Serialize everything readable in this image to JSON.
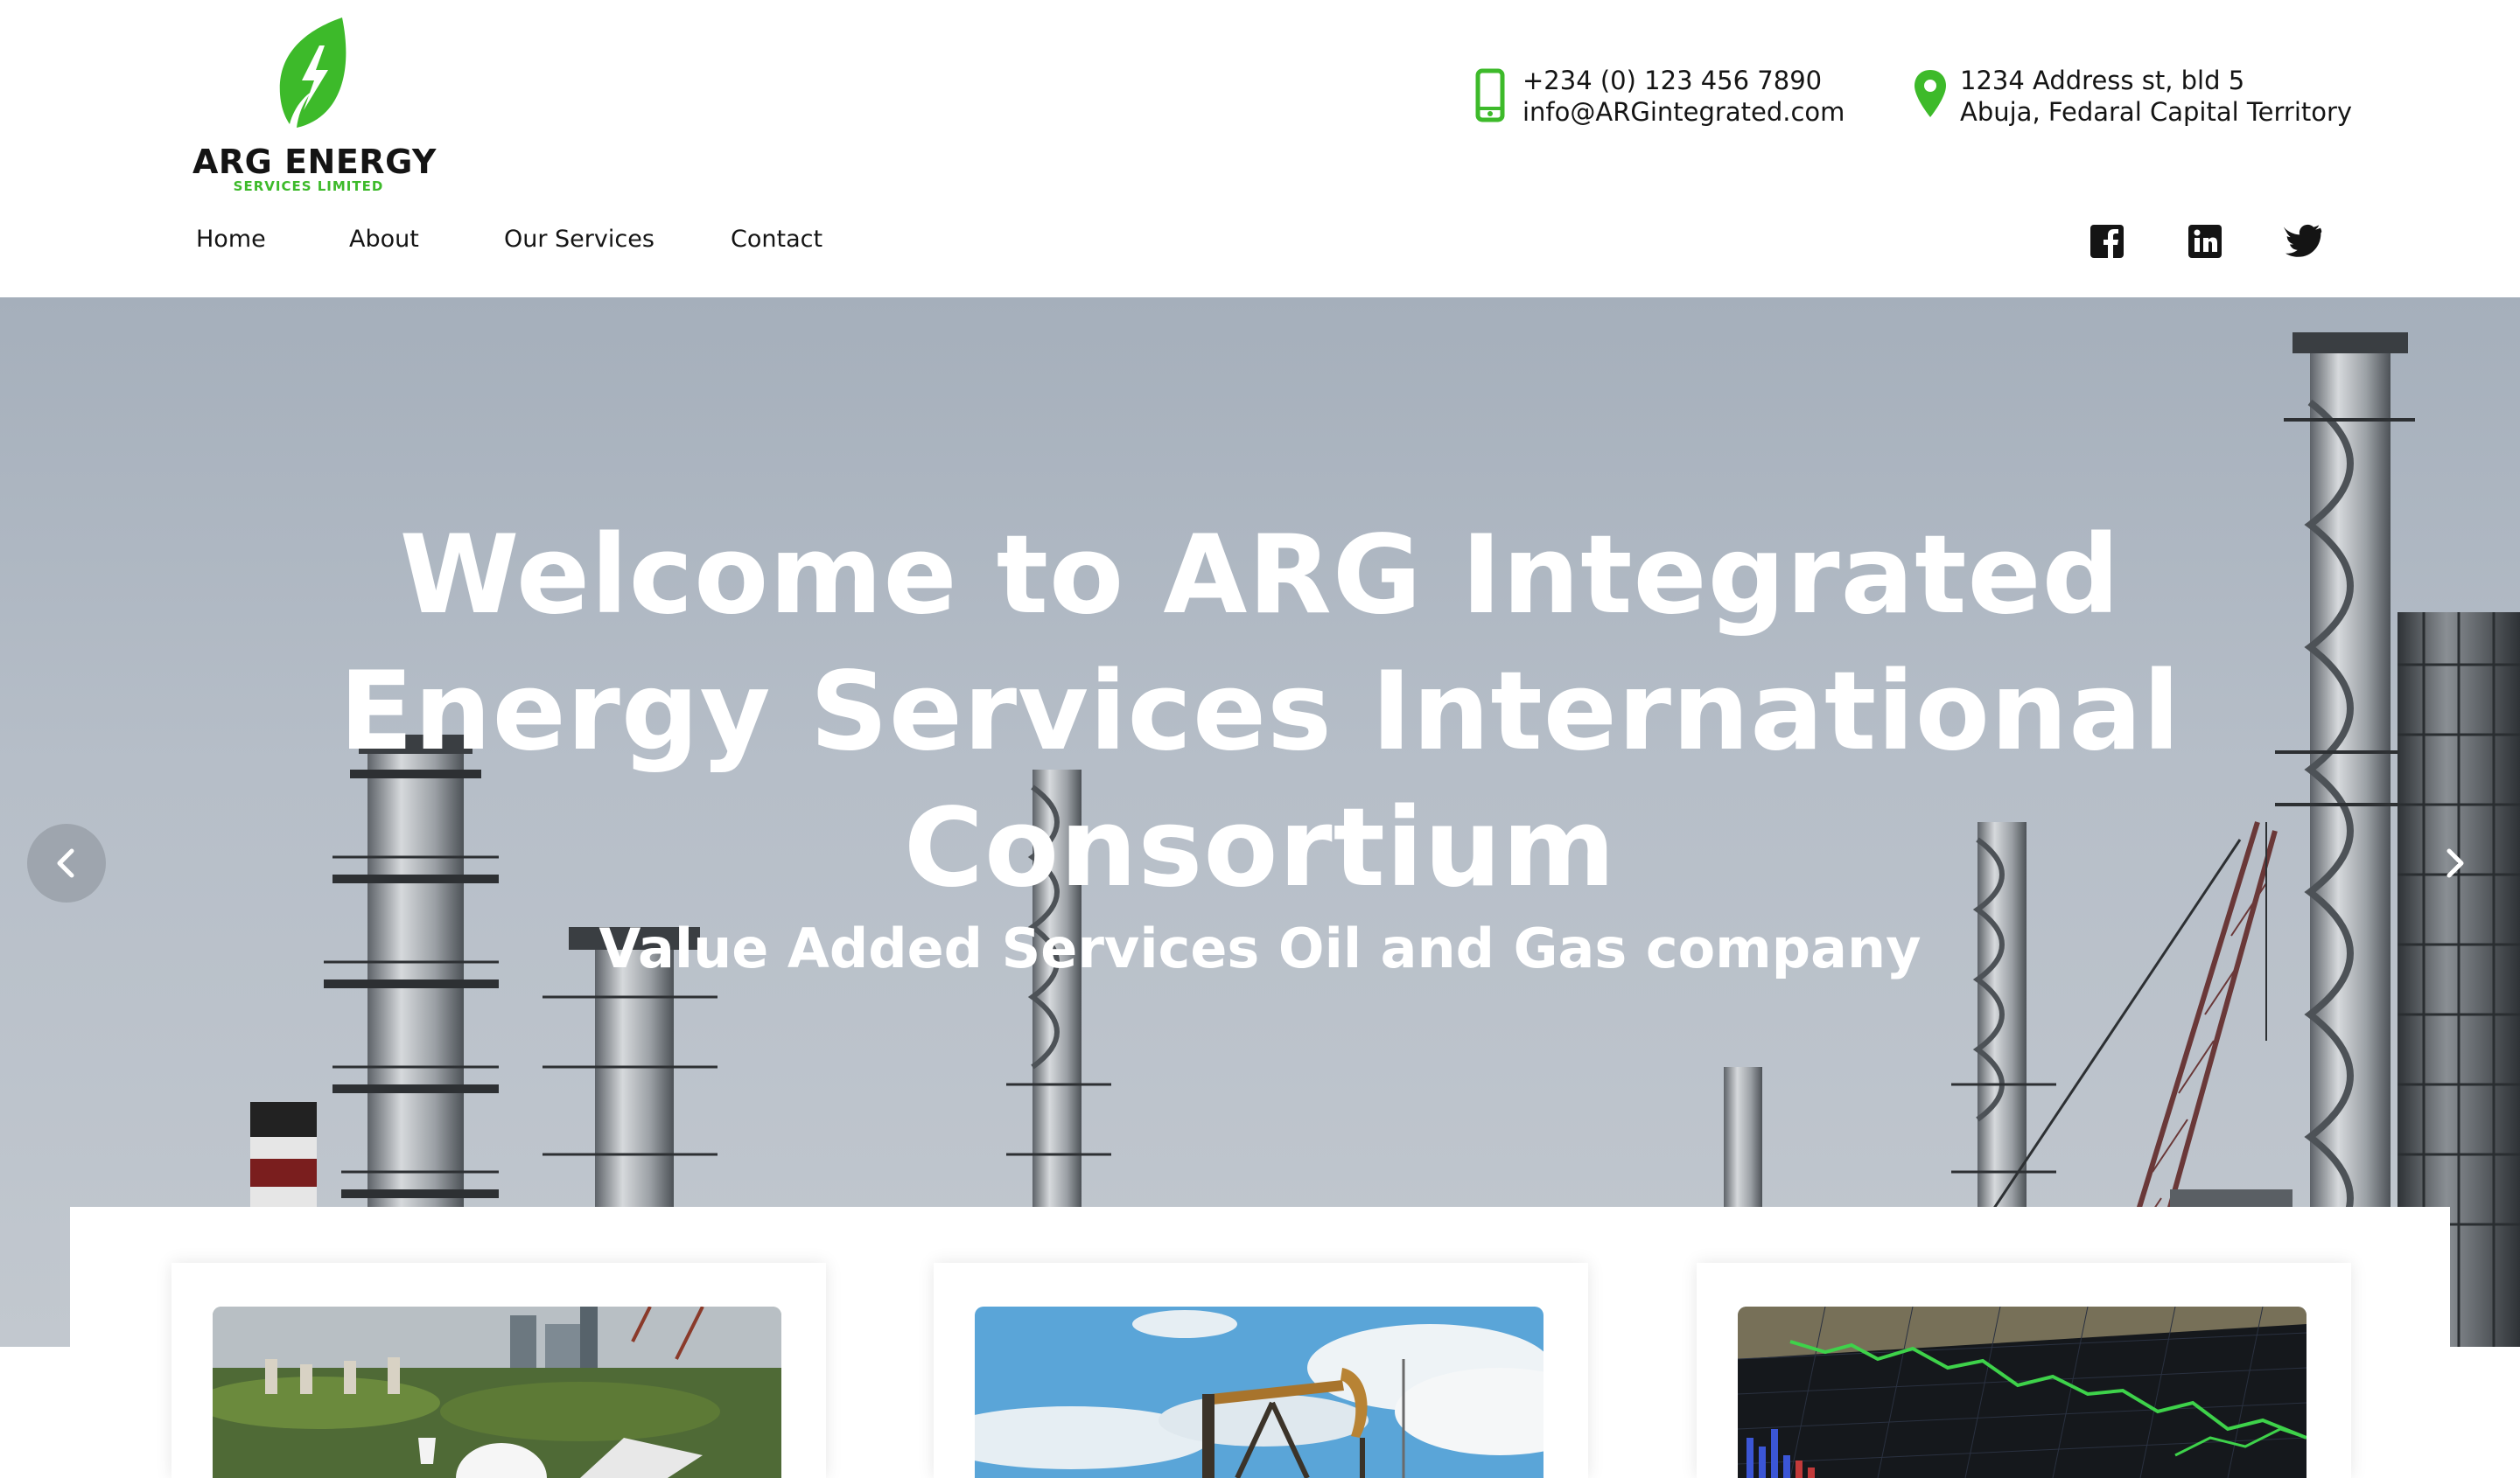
{
  "logo": {
    "title": "ARG ENERGY",
    "subtitle": "SERVICES LIMITED",
    "icon": "leaf-lightning-icon",
    "color": "#3dba2a"
  },
  "contact": {
    "phone": "+234 (0) 123 456 7890",
    "email": "info@ARGintegrated.com",
    "address_line1": "1234 Address st, bld 5",
    "address_line2": "Abuja, Fedaral Capital Territory"
  },
  "nav": {
    "items": [
      {
        "label": "Home"
      },
      {
        "label": "About"
      },
      {
        "label": "Our Services"
      },
      {
        "label": "Contact"
      }
    ]
  },
  "social": [
    "facebook-icon",
    "linkedin-icon",
    "twitter-icon"
  ],
  "hero": {
    "title": "Welcome to ARG Integrated Energy Services International Consortium",
    "subtitle": "Value Added Services Oil and Gas company",
    "prev_icon": "chevron-left-icon",
    "next_icon": "chevron-right-icon"
  },
  "services": {
    "cards": [
      {
        "image": "construction-site-image"
      },
      {
        "image": "oil-pumpjack-image"
      },
      {
        "image": "stock-chart-image"
      }
    ]
  },
  "colors": {
    "accent": "#3dba2a",
    "text": "#141414",
    "hero_text": "#ffffff"
  }
}
